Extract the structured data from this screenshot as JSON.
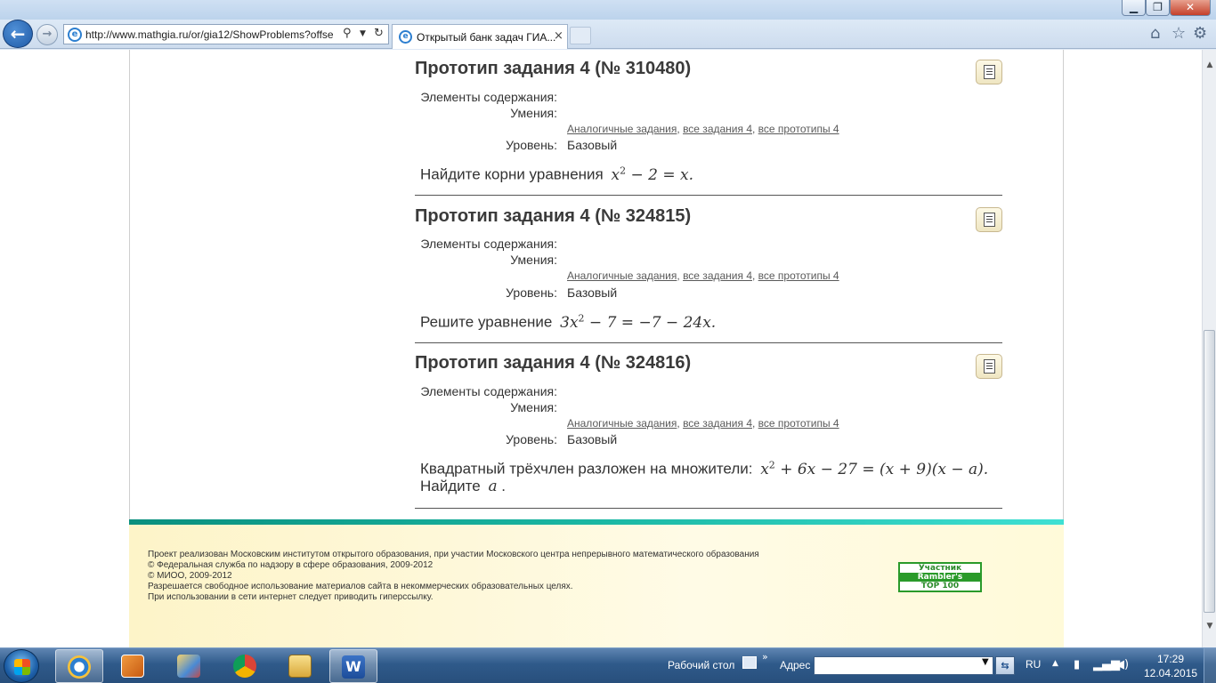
{
  "browser": {
    "url": "http://www.mathgia.ru/or/gia12/ShowProblems?offse",
    "tab_title": "Открытый банк задач ГИА...",
    "tab_close": "×"
  },
  "problems": [
    {
      "title": "Прототип задания 4 (№ 310480)",
      "label_elements": "Элементы содержания:",
      "label_skills": "Умения:",
      "link_similar": "Аналогичные задания",
      "link_all": "все задания 4",
      "link_prototypes": "все прототипы 4",
      "label_level": "Уровень:",
      "level": "Базовый",
      "statement": "Найдите корни уравнения",
      "formula_a": "x",
      "formula_b": "2",
      "formula_c": " − 2 = x",
      "line2": ""
    },
    {
      "title": "Прототип задания 4 (№ 324815)",
      "label_elements": "Элементы содержания:",
      "label_skills": "Умения:",
      "link_similar": "Аналогичные задания",
      "link_all": "все задания 4",
      "link_prototypes": "все прототипы 4",
      "label_level": "Уровень:",
      "level": "Базовый",
      "statement": "Решите уравнение",
      "formula_a": "3x",
      "formula_b": "2",
      "formula_c": " − 7 = −7 − 24x",
      "line2": ""
    },
    {
      "title": "Прототип задания 4 (№ 324816)",
      "label_elements": "Элементы содержания:",
      "label_skills": "Умения:",
      "link_similar": "Аналогичные задания",
      "link_all": "все задания 4",
      "link_prototypes": "все прототипы 4",
      "label_level": "Уровень:",
      "level": "Базовый",
      "statement": "Квадратный трёхчлен разложен на множители:",
      "formula_a": "x",
      "formula_b": "2",
      "formula_c": " + 6x − 27 = (x + 9)(x − a)",
      "line2": "Найдите",
      "line2_var": "a"
    }
  ],
  "footer": {
    "line1": "Проект реализован Московским институтом открытого образования, при участии Московского центра непрерывного математического образования",
    "line2": "© Федеральная служба по надзору в сфере образования, 2009-2012",
    "line3": "© МИОО, 2009-2012",
    "line4": "Разрешается свободное использование материалов сайта в некоммерческих образовательных целях.",
    "line5": "При использовании в сети интернет следует приводить гиперссылку.",
    "rambler_1": "Участник",
    "rambler_2": "Rambler's",
    "rambler_3": "TOP 100"
  },
  "taskbar": {
    "desktop_label": "Рабочий стол",
    "address_label": "Адрес",
    "lang": "RU",
    "time": "17:29",
    "date": "12.04.2015"
  }
}
